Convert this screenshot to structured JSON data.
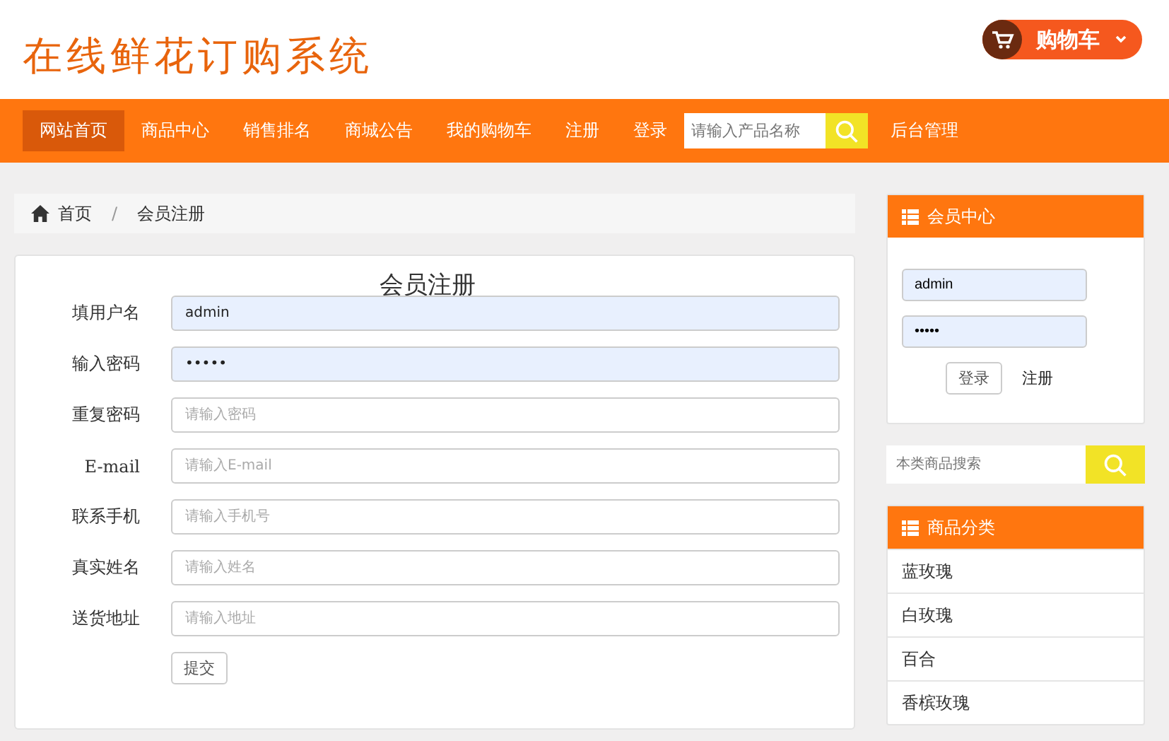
{
  "header": {
    "logo": "在线鲜花订购系统",
    "cart_button": "购物车"
  },
  "nav": {
    "items": [
      {
        "label": "网站首页",
        "selected": true
      },
      {
        "label": "商品中心",
        "selected": false
      },
      {
        "label": "销售排名",
        "selected": false
      },
      {
        "label": "商城公告",
        "selected": false
      },
      {
        "label": "我的购物车",
        "selected": false
      },
      {
        "label": "注册",
        "selected": false
      },
      {
        "label": "登录",
        "selected": false
      }
    ],
    "search": {
      "placeholder": "请输入产品名称"
    },
    "admin_link": "后台管理"
  },
  "breadcrumb": {
    "items": [
      "首页",
      "会员注册"
    ],
    "separator": "/"
  },
  "register_form": {
    "title": "会员注册",
    "fields": [
      {
        "label": "填用户名",
        "value": "admin",
        "autofilled": true
      },
      {
        "label": "输入密码",
        "value": "•••••",
        "autofilled": true
      },
      {
        "label": "重复密码",
        "placeholder": "请输入密码",
        "autofilled": false
      },
      {
        "label": "E-mail",
        "placeholder": "请输入E-mail",
        "autofilled": false
      },
      {
        "label": "联系手机",
        "placeholder": "请输入手机号",
        "autofilled": false
      },
      {
        "label": "真实姓名",
        "placeholder": "请输入姓名",
        "autofilled": false
      },
      {
        "label": "送货地址",
        "placeholder": "请输入地址",
        "autofilled": false
      }
    ],
    "submit": "提交"
  },
  "member_center": {
    "title": "会员中心",
    "username": "admin",
    "password": "•••••",
    "login_button": "登录",
    "register_link": "注册"
  },
  "category_search": {
    "placeholder": "本类商品搜索"
  },
  "categories": {
    "title": "商品分类",
    "items": [
      "蓝玫瑰",
      "白玫瑰",
      "百合",
      "香槟玫瑰"
    ]
  }
}
